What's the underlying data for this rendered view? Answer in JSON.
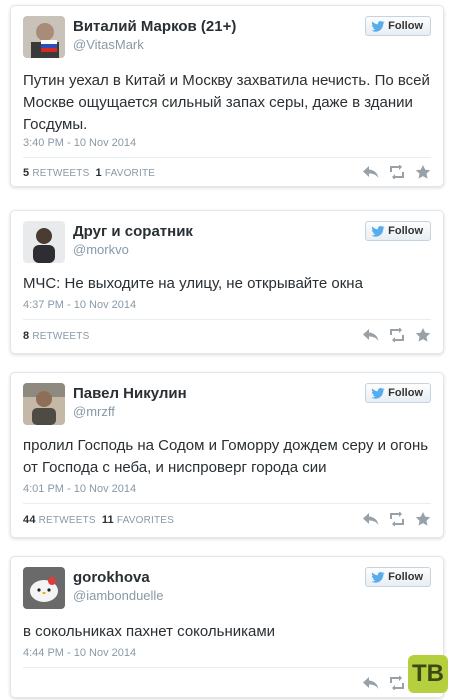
{
  "follow_label": "Follow",
  "tweets": [
    {
      "name": "Виталий Марков (21+)",
      "handle": "@VitasMark",
      "text": "Путин уехал в Китай и Москву захватила нечисть. По всей Москве ощущается сильный запах серы, даже в здании Госдумы.",
      "time": "3:40 PM - 10 Nov 2014",
      "retweets_count": "5",
      "retweets_label": "RETWEETS",
      "favorites_count": "1",
      "favorites_label": "FAVORITE"
    },
    {
      "name": "Друг и соратник",
      "handle": "@morkvo",
      "text": "МЧС: Не выходите на улицу, не открывайте окна",
      "time": "4:37 PM - 10 Nov 2014",
      "retweets_count": "8",
      "retweets_label": "RETWEETS"
    },
    {
      "name": "Павел Никулин",
      "handle": "@mrzff",
      "text": "пролил Господь на Содом и Гоморру дождем серу и огонь от Господа с неба, и ниспроверг города сии",
      "time": "4:01 PM - 10 Nov 2014",
      "retweets_count": "44",
      "retweets_label": "RETWEETS",
      "favorites_count": "11",
      "favorites_label": "FAVORITES"
    },
    {
      "name": "gorokhova",
      "handle": "@iambonduelle",
      "text": "в сокольниках пахнет сокольниками",
      "time": "4:44 PM - 10 Nov 2014"
    }
  ],
  "watermark": "ТВ",
  "colors": {
    "twitter_blue": "#55acee",
    "muted": "#8899a6",
    "text": "#292f33",
    "watermark_bg": "#b6cf3e"
  }
}
